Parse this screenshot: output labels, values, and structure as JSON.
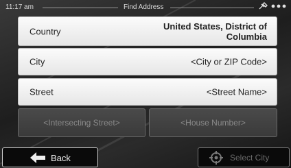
{
  "status": {
    "time": "11:17 am",
    "title": "Find Address",
    "icons": "satellite-icon, signal-dots-icon"
  },
  "fields": {
    "country": {
      "label": "Country",
      "value": "United States, District of Columbia"
    },
    "city": {
      "label": "City",
      "value": "<City or ZIP Code>"
    },
    "street": {
      "label": "Street",
      "value": "<Street Name>"
    },
    "intersecting_street": {
      "value": "<Intersecting Street>"
    },
    "house_number": {
      "value": "<House Number>"
    }
  },
  "buttons": {
    "back": "Back",
    "select_city": "Select City"
  }
}
